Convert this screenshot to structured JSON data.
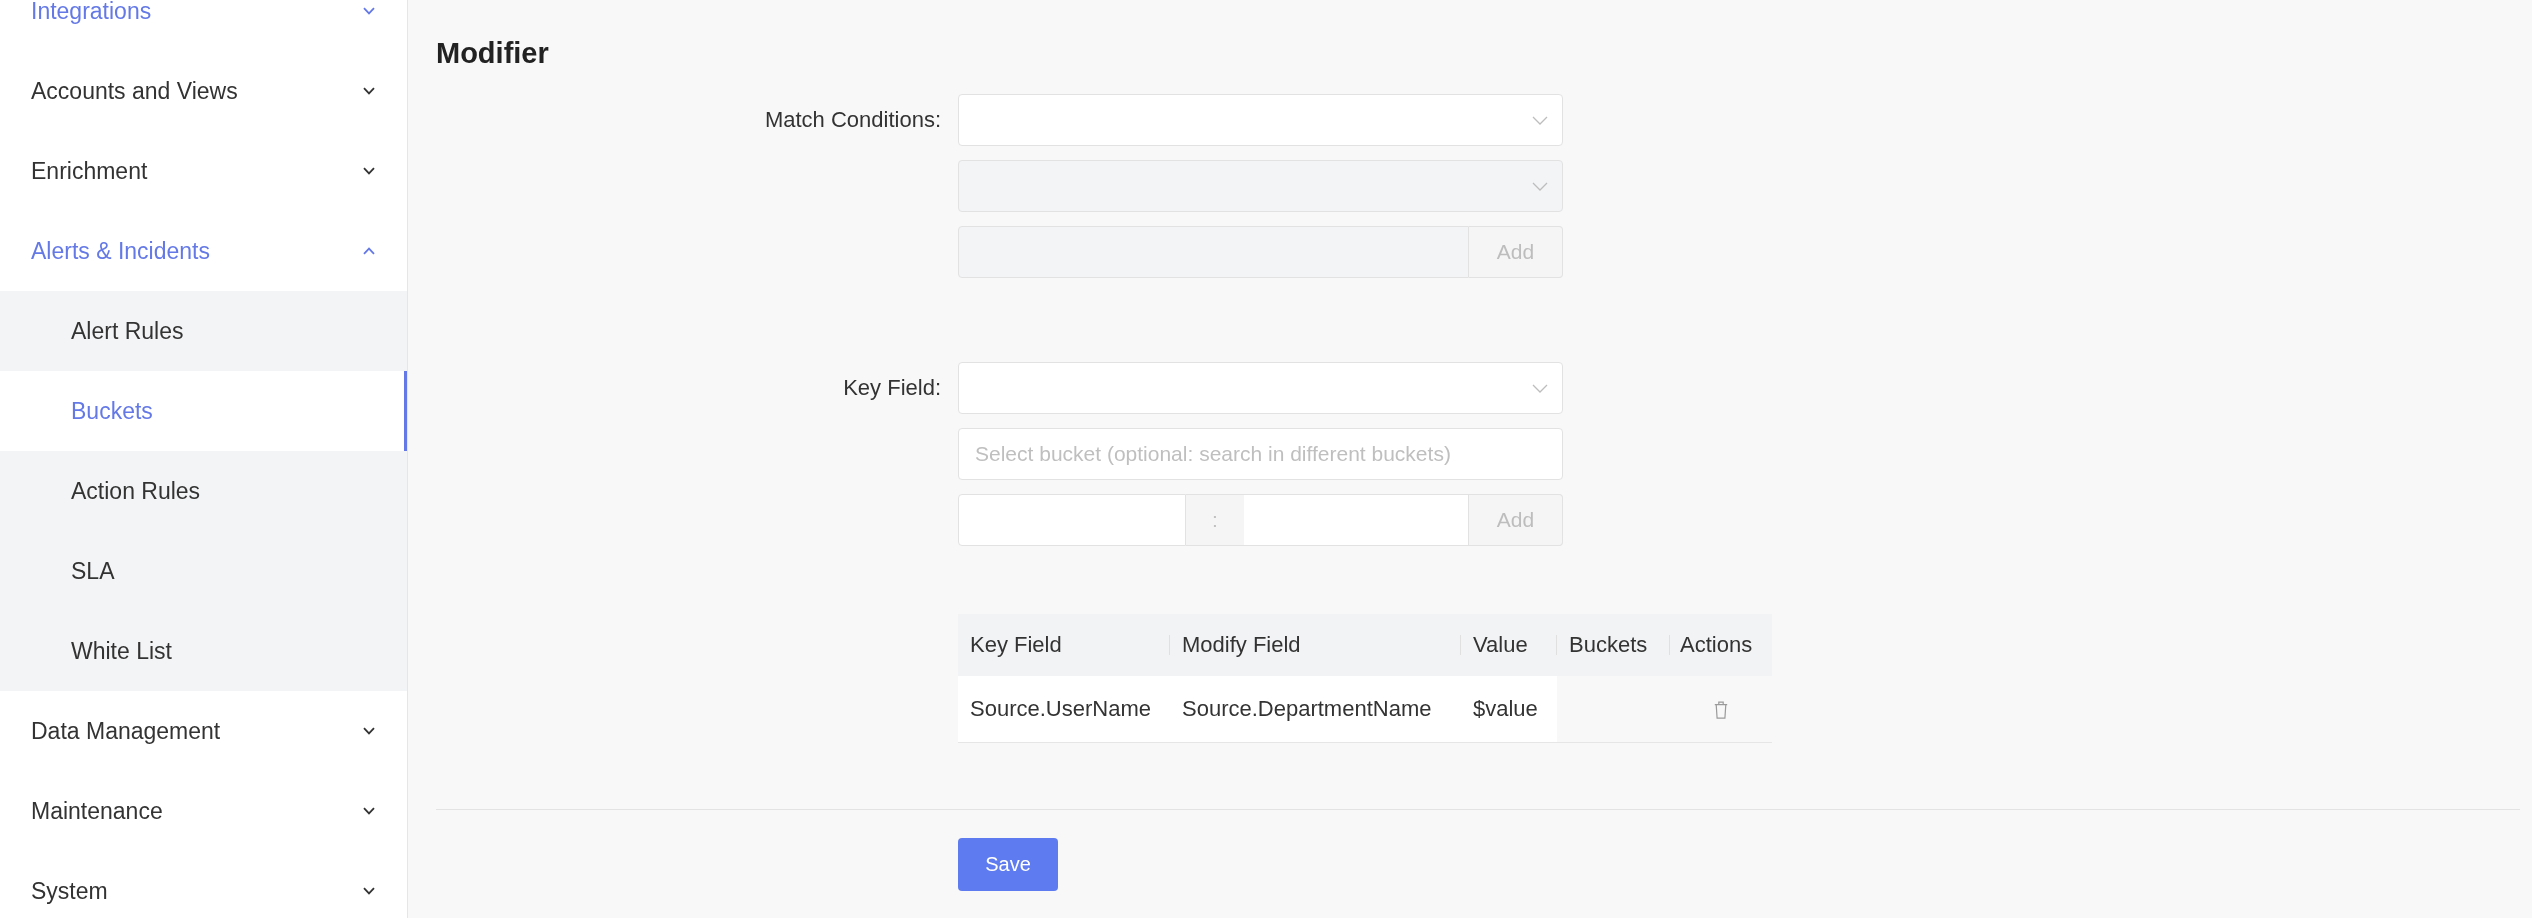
{
  "sidebar": {
    "items": [
      {
        "label": "Integrations",
        "highlighted": true,
        "expanded": false
      },
      {
        "label": "Accounts and Views",
        "highlighted": false,
        "expanded": false
      },
      {
        "label": "Enrichment",
        "highlighted": false,
        "expanded": false
      },
      {
        "label": "Alerts & Incidents",
        "highlighted": true,
        "expanded": true,
        "children": [
          {
            "label": "Alert Rules",
            "selected": false
          },
          {
            "label": "Buckets",
            "selected": true
          },
          {
            "label": "Action Rules",
            "selected": false
          },
          {
            "label": "SLA",
            "selected": false
          },
          {
            "label": "White List",
            "selected": false
          }
        ]
      },
      {
        "label": "Data Management",
        "highlighted": false,
        "expanded": false
      },
      {
        "label": "Maintenance",
        "highlighted": false,
        "expanded": false
      },
      {
        "label": "System",
        "highlighted": false,
        "expanded": false
      }
    ]
  },
  "modifier": {
    "title": "Modifier",
    "match_conditions": {
      "label": "Match Conditions:",
      "condition_select": {
        "disabled": false
      },
      "operator_select": {
        "disabled": true
      },
      "value_input": {
        "disabled": true
      },
      "add_button": {
        "label": "Add",
        "disabled": true
      }
    },
    "key_field": {
      "label": "Key Field:",
      "field_select": {
        "disabled": false
      },
      "bucket_select": {
        "placeholder": "Select bucket (optional: search in different buckets)"
      },
      "mapping": {
        "separator": ":",
        "add_button": {
          "label": "Add",
          "disabled": true
        }
      }
    },
    "table": {
      "columns": [
        {
          "label": "Key Field",
          "kind": "text"
        },
        {
          "label": "Modify Field",
          "kind": "text"
        },
        {
          "label": "Value",
          "kind": "text"
        },
        {
          "label": "Buckets",
          "kind": "text"
        },
        {
          "label": "Actions",
          "kind": "actions"
        }
      ],
      "rows": [
        {
          "cells": [
            "Source.UserName",
            "Source.DepartmentName",
            "$value"
          ]
        }
      ]
    },
    "save_button": {
      "label": "Save"
    }
  }
}
